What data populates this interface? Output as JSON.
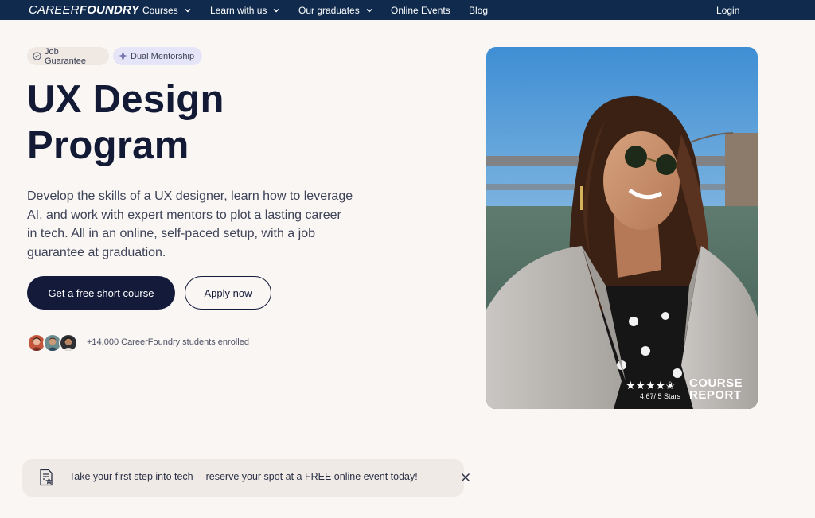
{
  "nav": {
    "logo_part1": "CAREER",
    "logo_part2": "FOUNDRY",
    "items": [
      {
        "label": "Courses",
        "has_dropdown": true
      },
      {
        "label": "Learn with us",
        "has_dropdown": true
      },
      {
        "label": "Our graduates",
        "has_dropdown": true
      },
      {
        "label": "Online Events",
        "has_dropdown": false
      },
      {
        "label": "Blog",
        "has_dropdown": false
      }
    ],
    "login_label": "Login",
    "background_color": "#0f2a4d"
  },
  "badges": [
    {
      "label": "Job Guarantee",
      "icon": "check-circle-icon"
    },
    {
      "label": "Dual Mentorship",
      "icon": "sparkle-icon"
    }
  ],
  "hero": {
    "title_line1": "UX Design",
    "title_line2": "Program",
    "description": "Develop the skills of a UX designer, learn how to leverage AI, and work with expert mentors to plot a lasting career in tech. All in an online, self-paced setup, with a job guarantee at graduation.",
    "primary_cta": "Get a free short course",
    "secondary_cta": "Apply now",
    "enrolled_text": "+14,000 CareerFoundry students enrolled",
    "image_alt": "Smiling woman with sunglasses in a grey blazer outdoors near a bridge"
  },
  "course_report": {
    "stars": "★★★★✬",
    "rating": "4,67/ 5 Stars",
    "logo_line1": "COURSE",
    "logo_line2": "REPORT"
  },
  "banner": {
    "text_prefix": "Take your first step into tech— ",
    "link_text": "reserve your spot at a FREE online event today!",
    "close_icon": "close-icon"
  },
  "colors": {
    "page_bg": "#faf6f3",
    "primary_dark": "#131a3a",
    "banner_bg": "#efeae6"
  }
}
